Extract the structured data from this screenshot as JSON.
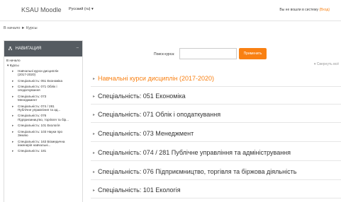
{
  "header": {
    "site_name": "KSAU Moodle",
    "language": "Русский (ru) ▾",
    "login_text": "Вы не вошли в систему",
    "login_link": "(Вход)"
  },
  "breadcrumb": {
    "home": "В начало",
    "separator": "►",
    "current": "Курсы"
  },
  "navigation": {
    "title": "НАВИГАЦИЯ",
    "collapse_label": "–",
    "home": "В начало",
    "courses": "▾ Курсы",
    "items": [
      {
        "line1": "Навчальні курси дисциплін",
        "line2": "(2017-2020)"
      },
      {
        "line1": "Спеціальність: 051 Економіка",
        "line2": ""
      },
      {
        "line1": "Спеціальність: 071 Облік і",
        "line2": "оподаткування"
      },
      {
        "line1": "Спеціальність: 073",
        "line2": "Менеджмент"
      },
      {
        "line1": "Спеціальність: 074 / 281",
        "line2": "Публічне управління та ад..."
      },
      {
        "line1": "Спеціальність: 076",
        "line2": "Підприємництво, торгівля та бір..."
      },
      {
        "line1": "Спеціальність: 101 Екологія",
        "line2": ""
      },
      {
        "line1": "Спеціальність: 103 Науки про",
        "line2": "Землю"
      },
      {
        "line1": "Спеціальність: 163 Біомедична",
        "line2": "інженерія навчальні..."
      },
      {
        "line1": "Спеціальність: 181",
        "line2": ""
      }
    ]
  },
  "search": {
    "label": "Поиск курса:",
    "value": "",
    "button": "Применить"
  },
  "collapse_all": "▾ Свернуть всё",
  "categories": [
    "Навчальні курси дисциплін (2017-2020)",
    "Спеціальність: 051 Економіка",
    "Спеціальність: 071 Облік і оподаткування",
    "Спеціальність: 073 Менеджмент",
    "Спеціальність: 074 / 281 Публічне управління та адміністрування",
    "Спеціальність: 076 Підприємництво, торгівля та біржова діяльність",
    "Спеціальність: 101 Екологія"
  ],
  "colors": {
    "accent": "#f98012",
    "nav_header": "#555b61"
  },
  "icons": {
    "nav": "sitemap-icon",
    "category": "triangle-right-icon"
  }
}
